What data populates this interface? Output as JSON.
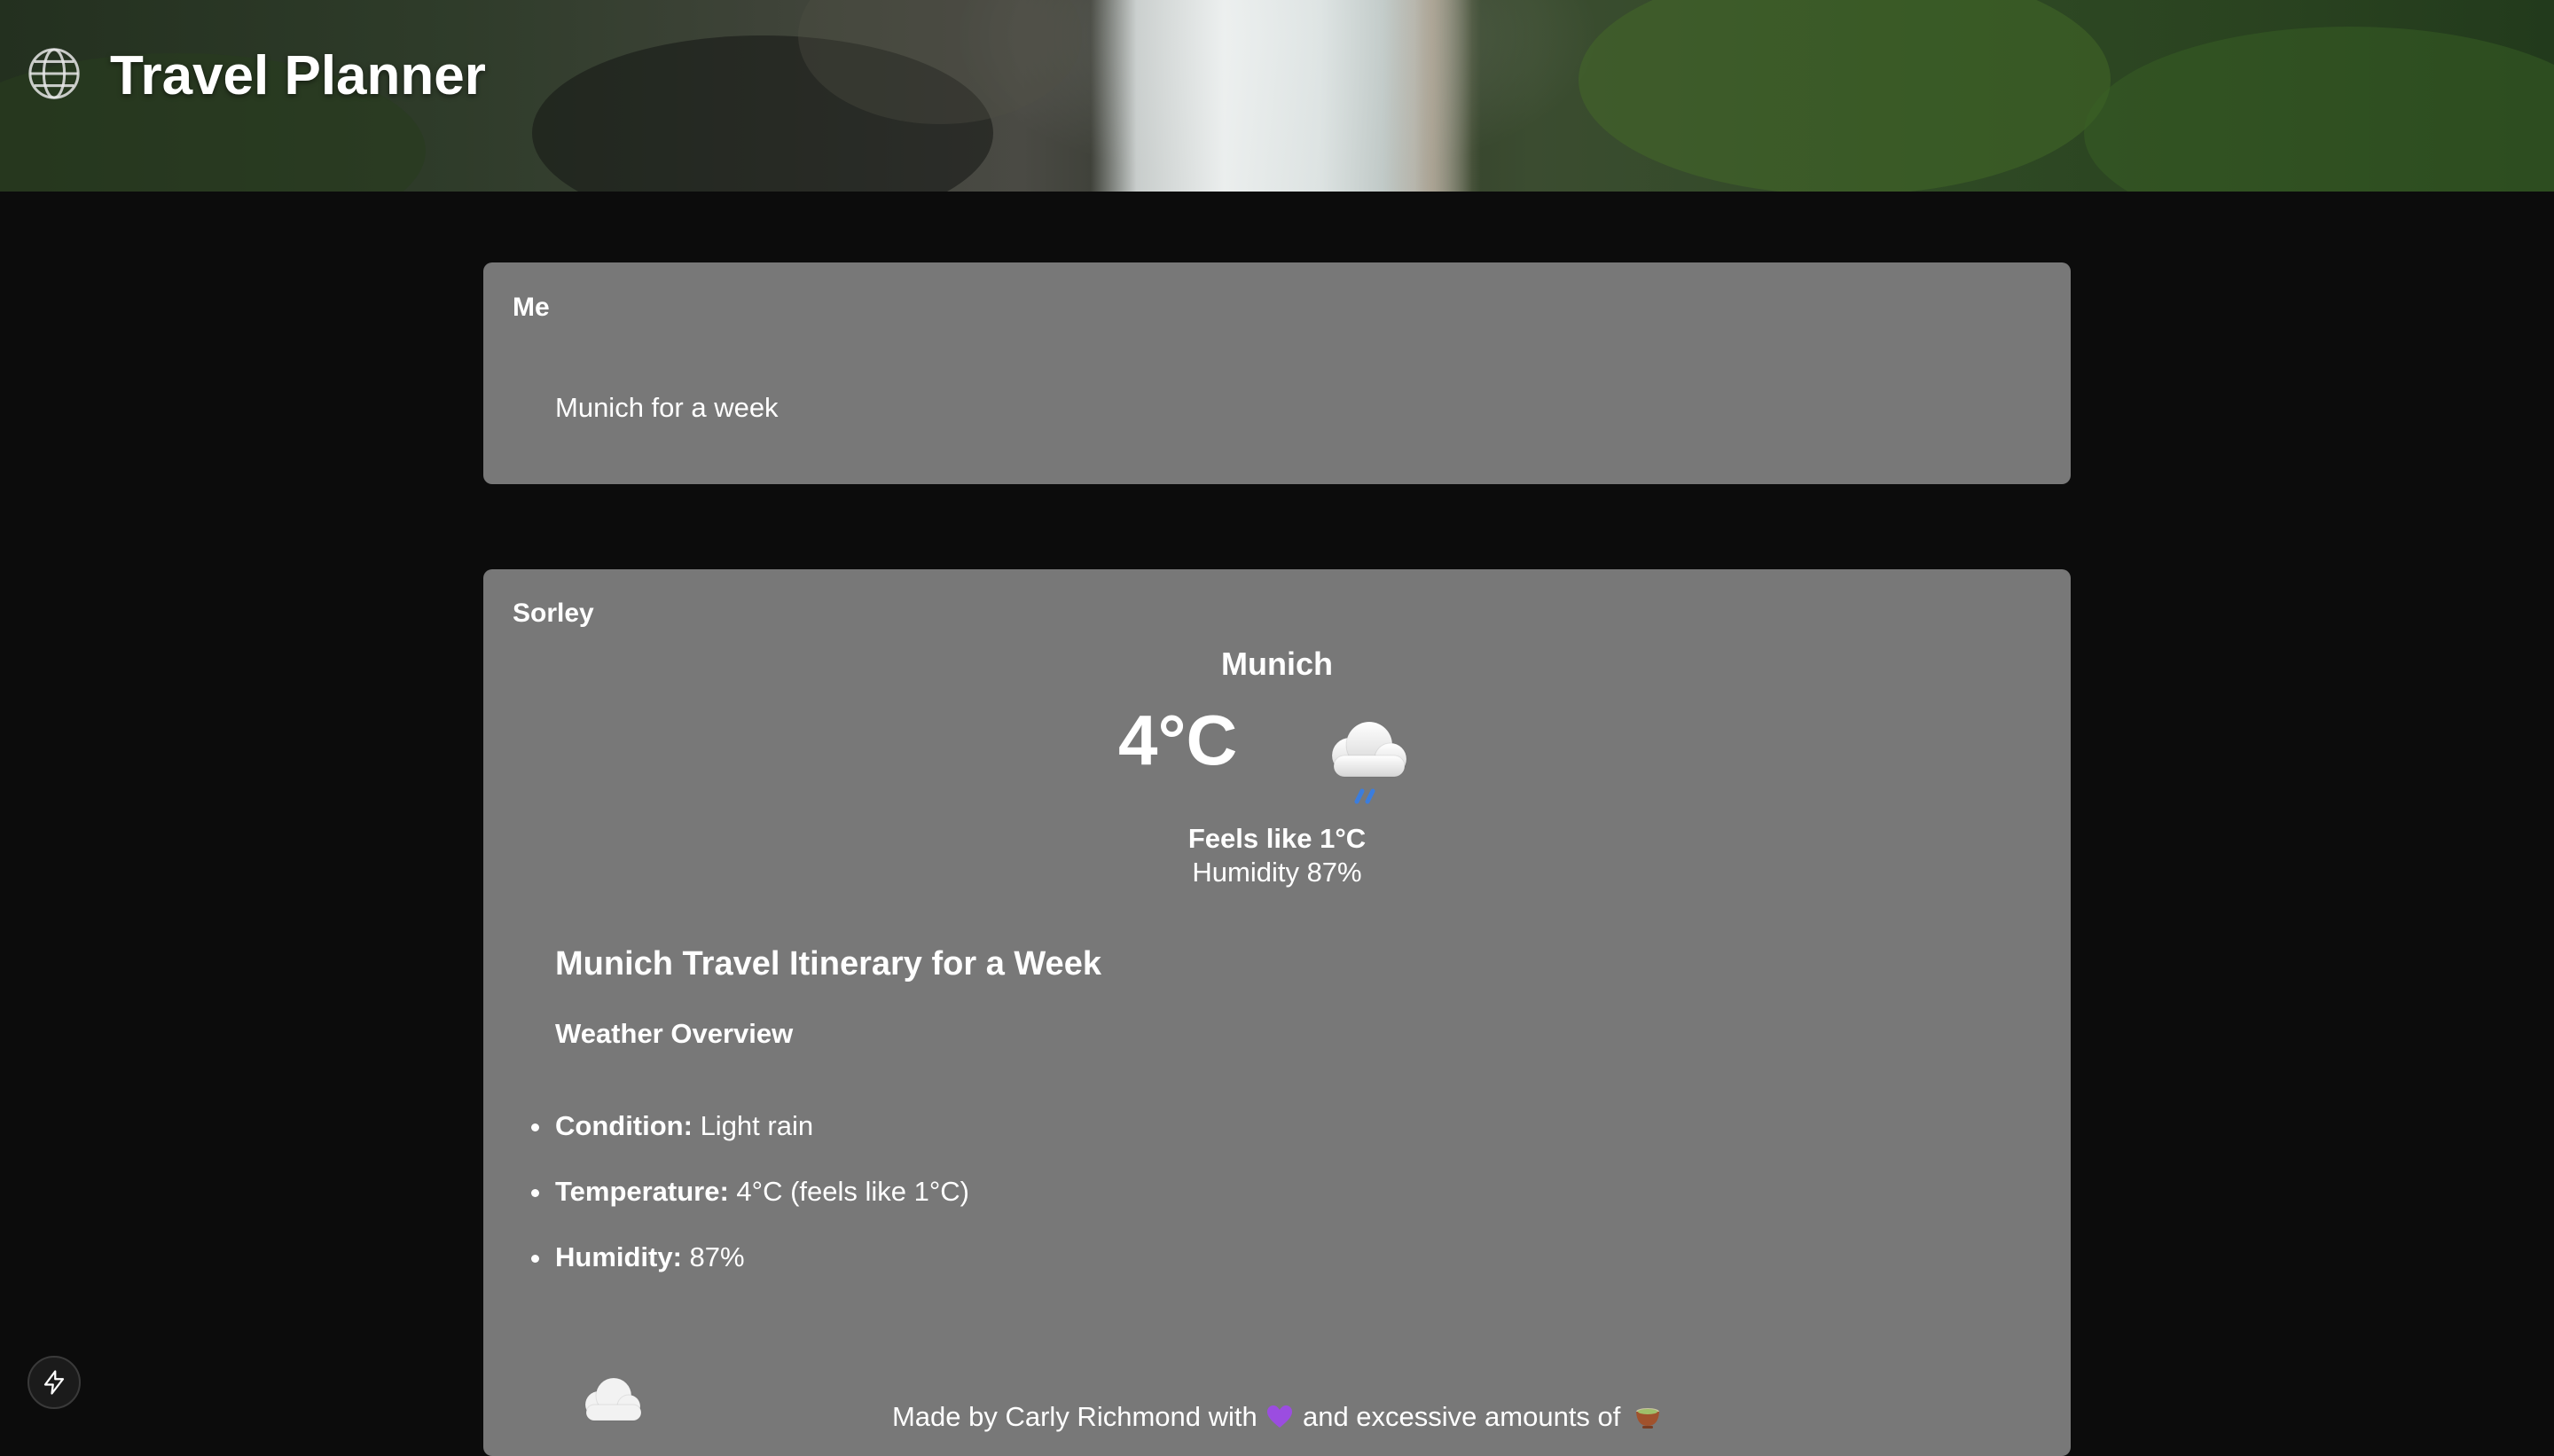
{
  "header": {
    "title": "Travel Planner",
    "icon": "globe-icon"
  },
  "conversation": [
    {
      "sender": "Me",
      "text": "Munich for a week"
    },
    {
      "sender": "Sorley",
      "weather": {
        "city": "Munich",
        "temperature": "4°C",
        "icon": "cloud-rain-icon",
        "feels_like": "Feels like 1°C",
        "humidity": "Humidity 87%"
      },
      "itinerary": {
        "title": "Munich Travel Itinerary for a Week",
        "subtitle": "Weather Overview",
        "facts": [
          {
            "label": "Condition:",
            "value": " Light rain"
          },
          {
            "label": "Temperature:",
            "value": " 4°C (feels like 1°C)"
          },
          {
            "label": "Humidity:",
            "value": " 87%"
          }
        ]
      }
    }
  ],
  "footer": {
    "text_before": "Made by Carly Richmond with ",
    "text_middle": " and excessive amounts of ",
    "heart_icon": "purple-heart-icon",
    "bowl_icon": "tea-bowl-icon"
  },
  "colors": {
    "background": "#0c0c0c",
    "card": "#787878",
    "text": "#ffffff",
    "rain": "#3b7ddd",
    "heart": "#9b4de0"
  }
}
